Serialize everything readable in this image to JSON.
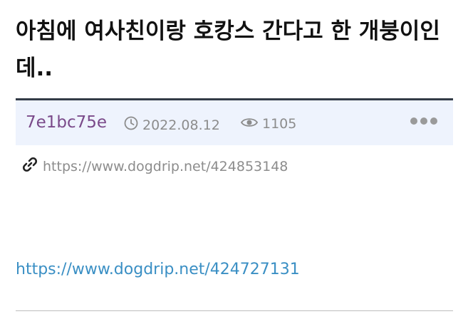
{
  "post": {
    "title": "아침에 여사친이랑 호캉스 간다고 한 개붕이인데..",
    "author": "7e1bc75e",
    "date": "2022.08.12",
    "views": "1105",
    "permalink": "https://www.dogdrip.net/424853148",
    "body_link": "https://www.dogdrip.net/424727131"
  },
  "icons": {
    "date": "clock-icon",
    "views": "eye-icon",
    "permalink": "link-icon",
    "more": "more-dots-icon"
  },
  "colors": {
    "meta_bg": "#eef3fd",
    "meta_border": "#333b47",
    "author": "#7a4a8a",
    "muted": "#8c8c8c",
    "link": "#3a8fc4"
  }
}
